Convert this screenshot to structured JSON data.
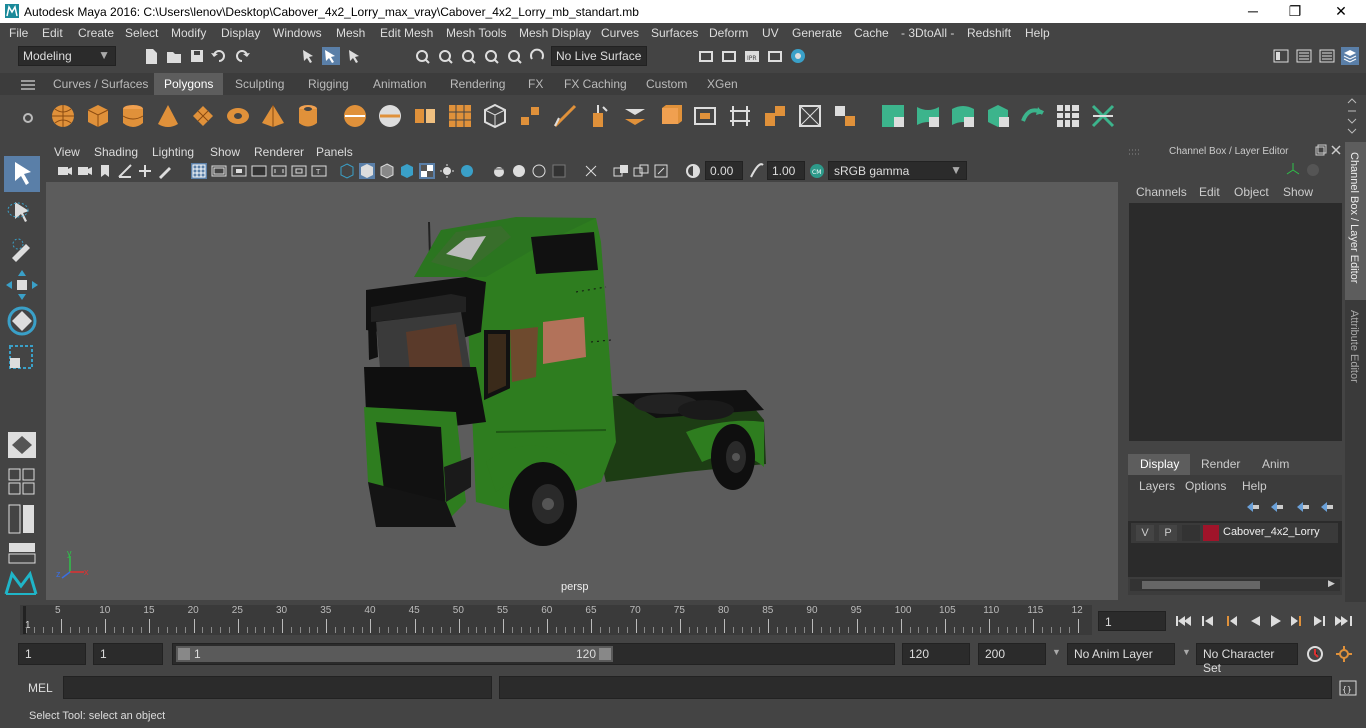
{
  "window": {
    "title": "Autodesk Maya 2016: C:\\Users\\lenov\\Desktop\\Cabover_4x2_Lorry_max_vray\\Cabover_4x2_Lorry_mb_standart.mb",
    "minimize": "─",
    "maximize": "❐",
    "close": "✕"
  },
  "menus": [
    "File",
    "Edit",
    "Create",
    "Select",
    "Modify",
    "Display",
    "Windows",
    "Mesh",
    "Edit Mesh",
    "Mesh Tools",
    "Mesh Display",
    "Curves",
    "Surfaces",
    "Deform",
    "UV",
    "Generate",
    "Cache",
    "- 3DtoAll -",
    "Redshift",
    "Help"
  ],
  "statusline": {
    "mode": "Modeling",
    "live_surface": "No Live Surface"
  },
  "shelf_tabs": [
    "Curves / Surfaces",
    "Polygons",
    "Sculpting",
    "Rigging",
    "Animation",
    "Rendering",
    "FX",
    "FX Caching",
    "Custom",
    "XGen"
  ],
  "viewport": {
    "menus": [
      "View",
      "Shading",
      "Lighting",
      "Show",
      "Renderer",
      "Panels"
    ],
    "exposure": "0.00",
    "gamma": "1.00",
    "colorspace": "sRGB gamma",
    "camera_label": "persp",
    "axis_x": "x",
    "axis_y": "y",
    "axis_z": "z"
  },
  "channel_box": {
    "title": "Channel Box / Layer Editor",
    "menus": [
      "Channels",
      "Edit",
      "Object",
      "Show"
    ],
    "layer_tabs": [
      "Display",
      "Render",
      "Anim"
    ],
    "layer_menus": [
      "Layers",
      "Options",
      "Help"
    ],
    "layer": {
      "v": "V",
      "p": "P",
      "name": "Cabover_4x2_Lorry",
      "color": "#a0142a"
    }
  },
  "side_tabs": {
    "channel_box": "Channel Box / Layer Editor",
    "attribute_editor": "Attribute Editor"
  },
  "timeline": {
    "ticks": [
      "5",
      "10",
      "15",
      "20",
      "25",
      "30",
      "35",
      "40",
      "45",
      "50",
      "55",
      "60",
      "65",
      "70",
      "75",
      "80",
      "85",
      "90",
      "95",
      "100",
      "105",
      "110",
      "115",
      "12"
    ],
    "first_tick": "1",
    "current_frame": "1"
  },
  "range": {
    "start": "1",
    "start2": "1",
    "slider_start": "1",
    "slider_end": "120",
    "end": "120",
    "end2": "200",
    "anim_layer": "No Anim Layer",
    "char_set": "No Character Set"
  },
  "mel": {
    "label": "MEL"
  },
  "help_line": "Select Tool: select an object",
  "colors": {
    "truck_body": "#2e7d1f",
    "accent": "#5d5d5d",
    "orange_icon": "#e0913a"
  }
}
